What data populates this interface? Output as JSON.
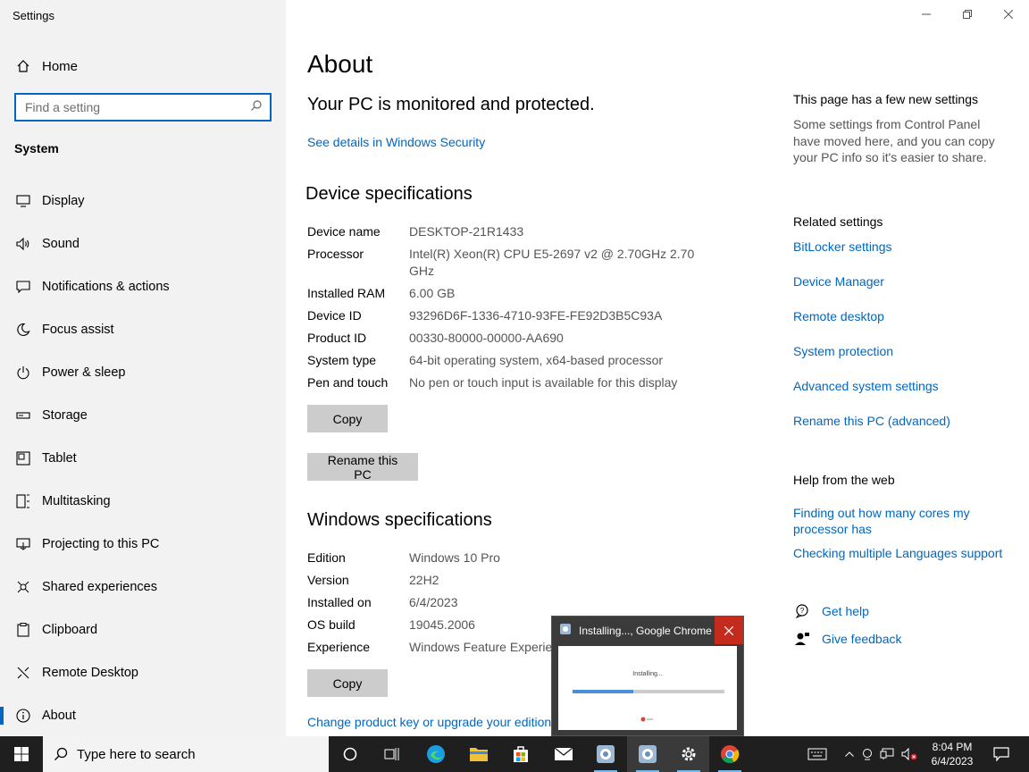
{
  "window": {
    "title": "Settings"
  },
  "sidebar": {
    "home": "Home",
    "search_placeholder": "Find a setting",
    "section": "System",
    "items": [
      {
        "label": "Display",
        "icon": "monitor-icon"
      },
      {
        "label": "Sound",
        "icon": "speaker-icon"
      },
      {
        "label": "Notifications & actions",
        "icon": "notification-icon"
      },
      {
        "label": "Focus assist",
        "icon": "moon-icon"
      },
      {
        "label": "Power & sleep",
        "icon": "power-icon"
      },
      {
        "label": "Storage",
        "icon": "storage-icon"
      },
      {
        "label": "Tablet",
        "icon": "tablet-icon"
      },
      {
        "label": "Multitasking",
        "icon": "multitasking-icon"
      },
      {
        "label": "Projecting to this PC",
        "icon": "projector-icon"
      },
      {
        "label": "Shared experiences",
        "icon": "shared-icon"
      },
      {
        "label": "Clipboard",
        "icon": "clipboard-icon"
      },
      {
        "label": "Remote Desktop",
        "icon": "remote-desktop-icon"
      },
      {
        "label": "About",
        "icon": "info-icon",
        "active": true
      }
    ]
  },
  "main": {
    "title": "About",
    "protection": "Your PC is monitored and protected.",
    "security_link": "See details in Windows Security",
    "device_heading": "Device specifications",
    "device_specs": [
      {
        "k": "Device name",
        "v": "DESKTOP-21R1433"
      },
      {
        "k": "Processor",
        "v": "Intel(R) Xeon(R) CPU E5-2697 v2 @ 2.70GHz   2.70 GHz"
      },
      {
        "k": "Installed RAM",
        "v": "6.00 GB"
      },
      {
        "k": "Device ID",
        "v": "93296D6F-1336-4710-93FE-FE92D3B5C93A"
      },
      {
        "k": "Product ID",
        "v": "00330-80000-00000-AA690"
      },
      {
        "k": "System type",
        "v": "64-bit operating system, x64-based processor"
      },
      {
        "k": "Pen and touch",
        "v": "No pen or touch input is available for this display"
      }
    ],
    "copy_label": "Copy",
    "rename_label": "Rename this PC",
    "windows_heading": "Windows specifications",
    "windows_specs": [
      {
        "k": "Edition",
        "v": "Windows 10 Pro"
      },
      {
        "k": "Version",
        "v": "22H2"
      },
      {
        "k": "Installed on",
        "v": "6/4/2023"
      },
      {
        "k": "OS build",
        "v": "19045.2006"
      },
      {
        "k": "Experience",
        "v": "Windows Feature Experience Pack 120.2212.4180.0"
      }
    ],
    "copy2_label": "Copy",
    "product_key_link": "Change product key or upgrade your edition of Windows"
  },
  "right": {
    "new_title": "This page has a few new settings",
    "new_desc": "Some settings from Control Panel have moved here, and you can copy your PC info so it's easier to share.",
    "related_title": "Related settings",
    "related_links": [
      "BitLocker settings",
      "Device Manager",
      "Remote desktop",
      "System protection",
      "Advanced system settings",
      "Rename this PC (advanced)"
    ],
    "web_title": "Help from the web",
    "web_links": [
      "Finding out how many cores my processor has",
      "Checking multiple Languages support"
    ],
    "get_help": "Get help",
    "feedback": "Give feedback"
  },
  "preview": {
    "title": "Installing..., Google Chrome",
    "thumb_text": "Installing...",
    "progress": 0.4
  },
  "taskbar": {
    "search_placeholder": "Type here to search",
    "time": "8:04 PM",
    "date": "6/4/2023"
  }
}
